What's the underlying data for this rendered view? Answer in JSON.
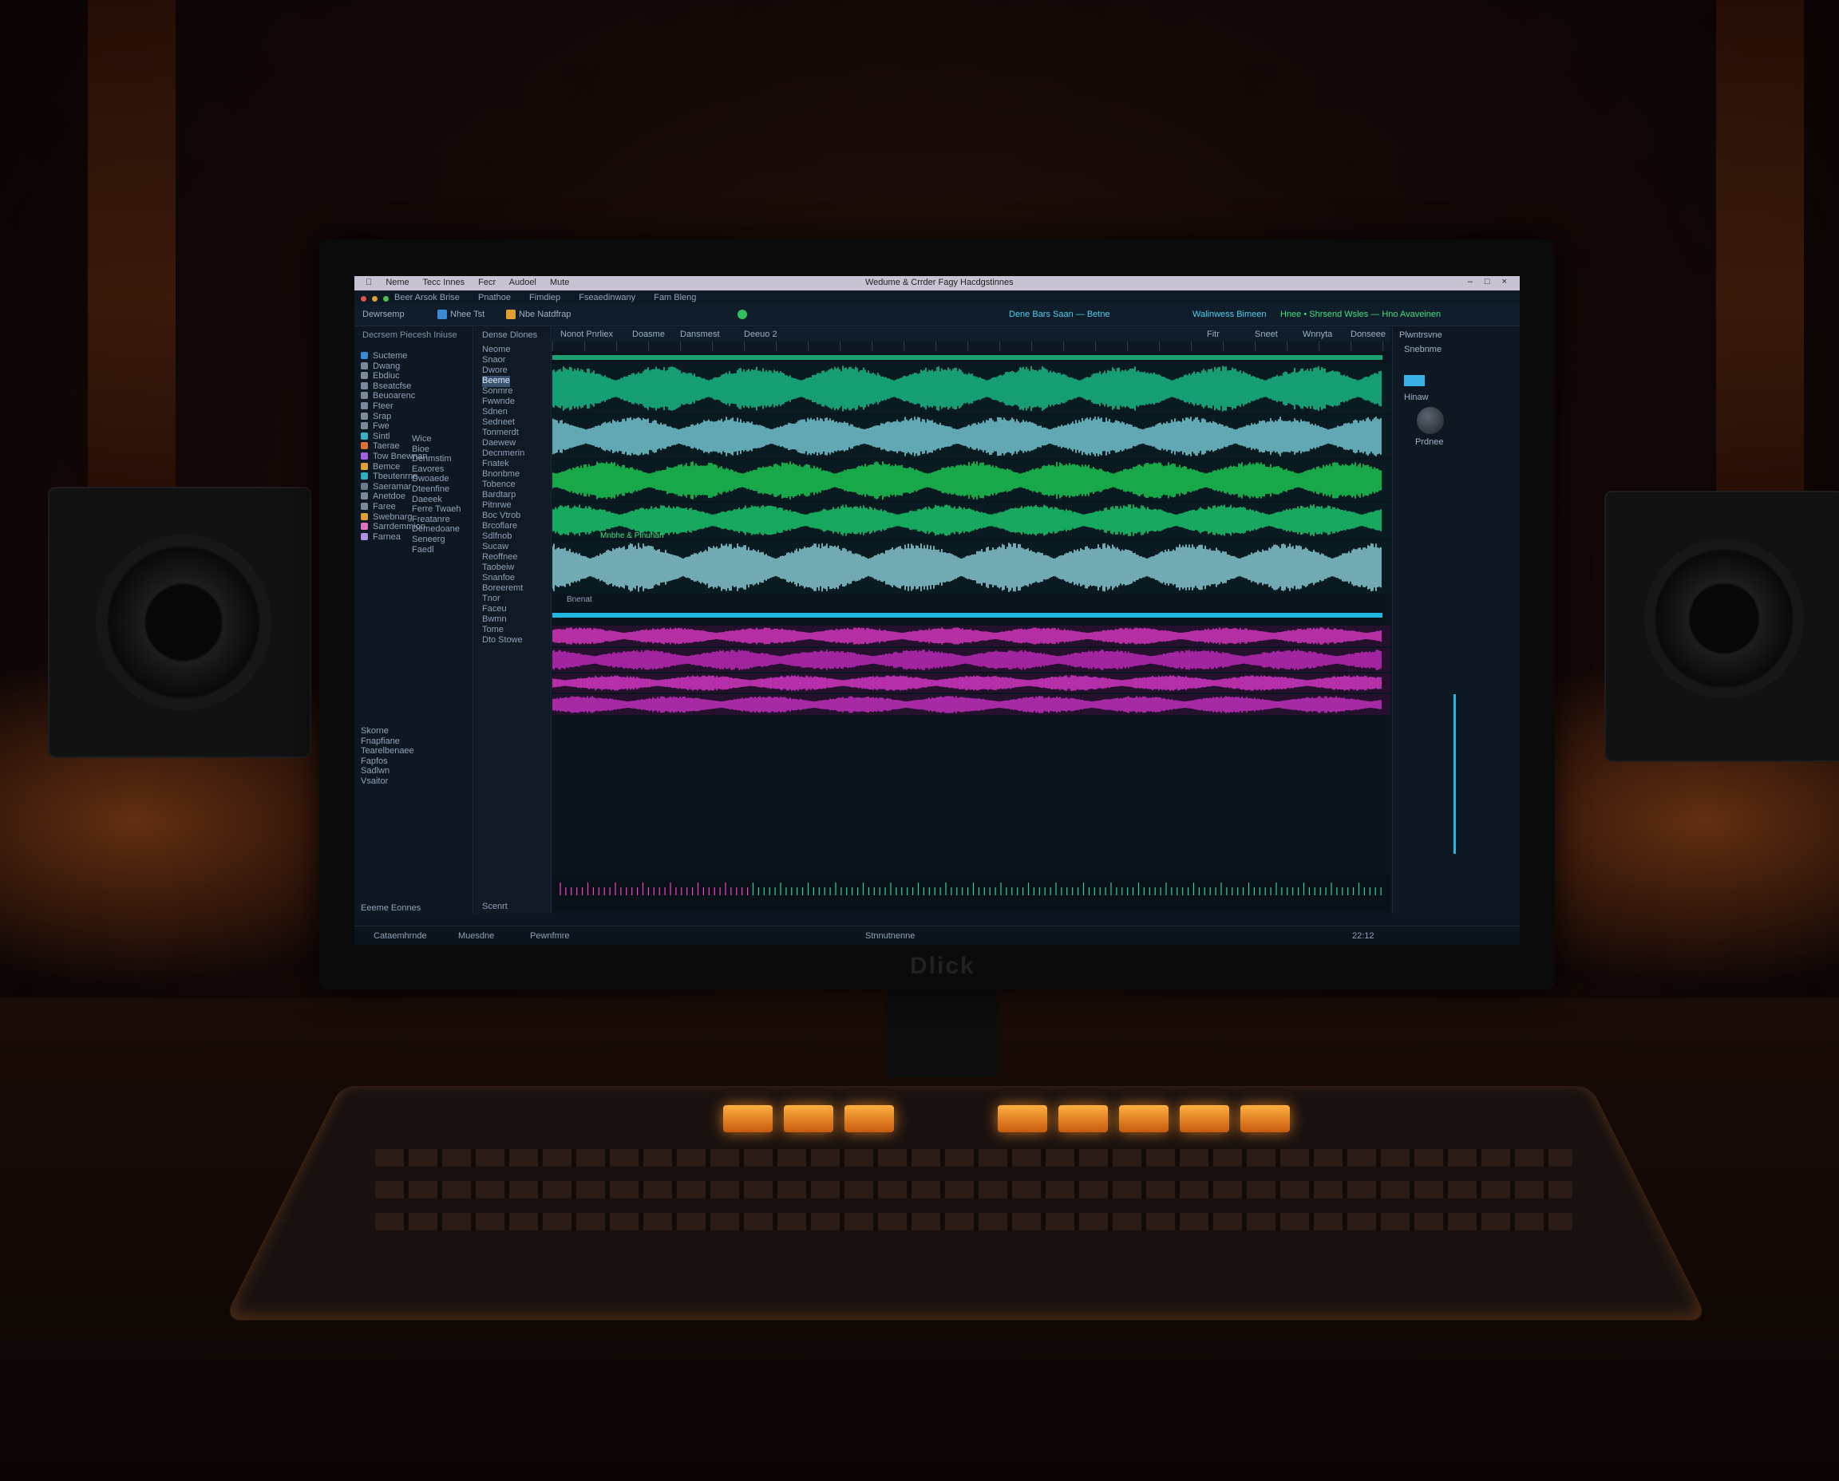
{
  "window": {
    "title": "Wedume & Crrder Fagy Hacdgstinnes",
    "menu": [
      "Neme",
      "Tecc Innes",
      "Fecr",
      "Audoel",
      "Mute"
    ],
    "controls": "‒ □ ×"
  },
  "menubar": {
    "items": [
      "Beer Arsok Brise",
      "Pnathoe",
      "Fimdiep",
      "Fseaedinwany",
      "Fam Bleng"
    ]
  },
  "toolbar": {
    "left_label": "Dewrsemp",
    "mode_label": "Nhee Tst",
    "project_label": "Nbe Natdfrap",
    "center_label": "Dene Bars Saan — Betne",
    "right_label": "Walinwess Bimeen",
    "right_label_2": "Hnee • Shrsend Wsles — Hno Avaveinen"
  },
  "sidebar": {
    "header": "Decrsem Piecesh Iniuse",
    "items": [
      {
        "label": "Sucteme",
        "color": "#3a8ad6"
      },
      {
        "label": "Dwang",
        "color": "#7a8a9a"
      },
      {
        "label": "Ebdiuc",
        "color": "#7a8a9a"
      },
      {
        "label": "Bseatcfse",
        "color": "#7a8a9a"
      },
      {
        "label": "Beuoarenc",
        "color": "#7a8a9a"
      },
      {
        "label": "Fteer",
        "color": "#7a8a9a"
      },
      {
        "label": "Srap",
        "color": "#7a8a9a"
      },
      {
        "label": "Fwe",
        "color": "#7a8a9a"
      },
      {
        "label": "Sintl",
        "color": "#3ab0c8"
      },
      {
        "label": "Taerae",
        "color": "#e07030"
      },
      {
        "label": "Tow Bnewnan",
        "color": "#a060e0"
      },
      {
        "label": "Bemce",
        "color": "#e0a030"
      },
      {
        "label": "Tbeutenrne",
        "color": "#30b0c0"
      },
      {
        "label": "Saeramar",
        "color": "#6a7a8a"
      },
      {
        "label": "Anetdoe",
        "color": "#7a8a9a"
      },
      {
        "label": "Faree",
        "color": "#7a8a9a"
      },
      {
        "label": "Swebnarg",
        "color": "#e0a030"
      },
      {
        "label": "Sarrdemmion",
        "color": "#e070c0"
      },
      {
        "label": "Farnea",
        "color": "#b090e0"
      }
    ],
    "sub_items": [
      "Wice",
      "Bioe",
      "Denmstim",
      "Eavores",
      "Dwoaede",
      "Dteenfine",
      "Daeeek",
      "Ferre Twaeh",
      "Freatanre",
      "Demedoane",
      "Seneerg",
      "Faedl"
    ],
    "bottom_items": [
      "Skorne",
      "Fnapfiane",
      "Tearelbenaee",
      "Fapfos",
      "Sadlwn",
      "Vsaitor"
    ],
    "footer": "Eeeme Eonnes"
  },
  "browser": {
    "header": "Dense Dlones",
    "items": [
      "Neome",
      "Snaor",
      "Dwore",
      "Beeme",
      "Sonmre",
      "Fwwnde",
      "Sdnen",
      "Sedneet",
      "Tonmerdt",
      "Daewew",
      "Decnmerin",
      "Fnatek",
      "Bnonbme",
      "Tobence",
      "Bardtarp",
      "Pitnrwe",
      "Boc Vtrob",
      "Brcoflare",
      "Sdlfnob",
      "Sucaw",
      "Reoffnee",
      "Taobeiw",
      "Snanfoe",
      "Boreeremt",
      "Tnor",
      "Faceu",
      "Bwmn",
      "Tome",
      "Dto Stowe"
    ],
    "footer": "Scenrt"
  },
  "editor": {
    "toolbar": [
      "Nonot Pnrliex",
      "Doasme",
      "Dansmest",
      "Deeuo 2"
    ],
    "clip_label": "Mnbhe & Plnunan",
    "lane_label": "Bnenat",
    "right_tools": [
      "Fitr",
      "Sneet",
      "Wnnyta",
      "Donseee"
    ],
    "tracks": [
      {
        "name": "green-top",
        "color": "#1ee0a0"
      },
      {
        "name": "cyan-1",
        "color": "#8ff0ff"
      },
      {
        "name": "green-2",
        "color": "#20f060"
      },
      {
        "name": "green-3",
        "color": "#20f080"
      },
      {
        "name": "cyan-2",
        "color": "#a8f4ff"
      },
      {
        "name": "blue-bar",
        "color": "#20b8e0"
      },
      {
        "name": "magenta-1",
        "color": "#ff40e0"
      },
      {
        "name": "magenta-2",
        "color": "#e030d8"
      },
      {
        "name": "magenta-3",
        "color": "#ff40e8"
      },
      {
        "name": "magenta-4",
        "color": "#e838e0"
      }
    ]
  },
  "rightpanel": {
    "header": "Plwntrsvne",
    "items": [
      "Snebnme",
      "Hinaw",
      "Prdnee"
    ]
  },
  "statusbar": {
    "left": "Cataemhrnde",
    "mid1": "Muesdne",
    "mid2": "Pewnfmre",
    "right": "Stnnutnenne",
    "clock": "22:12"
  },
  "brand": "Dlick"
}
